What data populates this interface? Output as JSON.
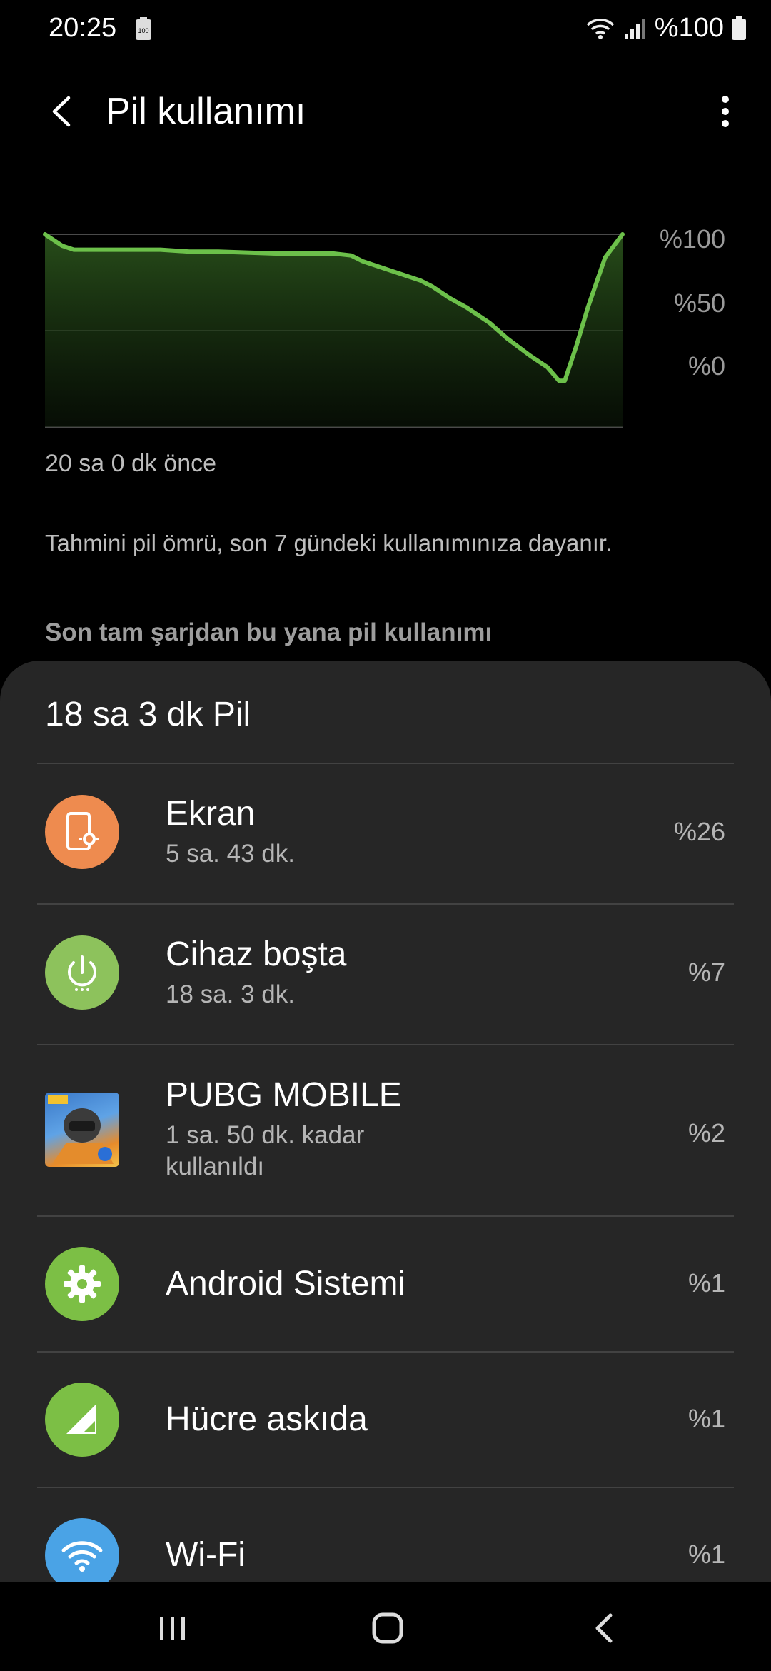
{
  "status": {
    "time": "20:25",
    "battery_small": "100",
    "battery_pct": "%100"
  },
  "header": {
    "title": "Pil kullanımı"
  },
  "chart_data": {
    "type": "area",
    "y_ticks": [
      "%100",
      "%50",
      "%0"
    ],
    "ylim": [
      0,
      100
    ],
    "x_start_label": "20 sa 0 dk önce",
    "line_color": "#6cc04a",
    "x": [
      0,
      3,
      5,
      8,
      12,
      20,
      25,
      30,
      40,
      45,
      50,
      53,
      55,
      60,
      65,
      67,
      70,
      73,
      77,
      80,
      84,
      87,
      89,
      90,
      92,
      94,
      97,
      100
    ],
    "values": [
      100,
      94,
      92,
      92,
      92,
      92,
      91,
      91,
      90,
      90,
      90,
      89,
      86,
      81,
      76,
      73,
      67,
      62,
      54,
      46,
      37,
      31,
      24,
      24,
      42,
      62,
      88,
      100
    ]
  },
  "info": {
    "estimate_text": "Tahmini pil ömrü, son 7 gündeki kullanımınıza dayanır.",
    "section_title": "Son tam şarjdan bu yana pil kullanımı"
  },
  "card": {
    "total": "18 sa 3 dk Pil",
    "items": [
      {
        "title": "Ekran",
        "sub": "5 sa. 43 dk.",
        "pct": "%26",
        "icon": "screen-brightness-icon",
        "color": "#ee8b4f"
      },
      {
        "title": "Cihaz boşta",
        "sub": "18 sa. 3 dk.",
        "pct": "%7",
        "icon": "power-idle-icon",
        "color": "#8dc25c"
      },
      {
        "title": "PUBG MOBILE",
        "sub": "1 sa. 50 dk. kadar kullanıldı",
        "pct": "%2",
        "icon": "pubg-app-icon"
      },
      {
        "title": "Android Sistemi",
        "sub": "",
        "pct": "%1",
        "icon": "gear-icon",
        "color": "#7cbf45"
      },
      {
        "title": "Hücre askıda",
        "sub": "",
        "pct": "%1",
        "icon": "cell-signal-icon",
        "color": "#7cbf45"
      },
      {
        "title": "Wi-Fi",
        "sub": "",
        "pct": "%1",
        "icon": "wifi-icon",
        "color": "#4aa3e6"
      }
    ]
  }
}
